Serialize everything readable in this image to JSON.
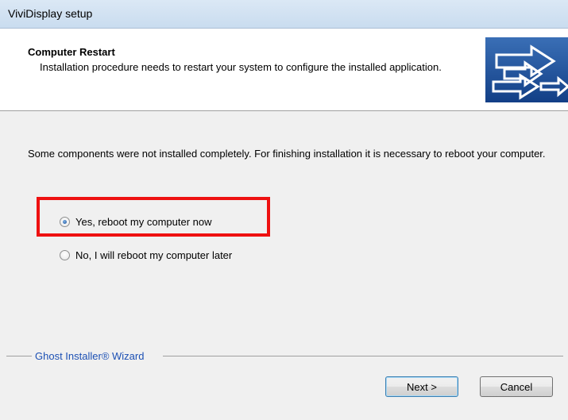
{
  "window": {
    "title": "ViviDisplay setup"
  },
  "header": {
    "title": "Computer Restart",
    "subtitle": "Installation procedure needs to restart your system to configure the installed application.",
    "logo_icon": "arrows-logo-icon"
  },
  "content": {
    "message": "Some components were not installed completely. For finishing installation it is necessary to reboot your computer.",
    "options": [
      {
        "label": "Yes, reboot my computer now",
        "checked": true
      },
      {
        "label": "No, I will reboot my computer later",
        "checked": false
      }
    ],
    "highlight_color": "#ee1111"
  },
  "footer": {
    "wizard_label": "Ghost Installer® Wizard",
    "next_label": "Next >",
    "cancel_label": "Cancel"
  }
}
